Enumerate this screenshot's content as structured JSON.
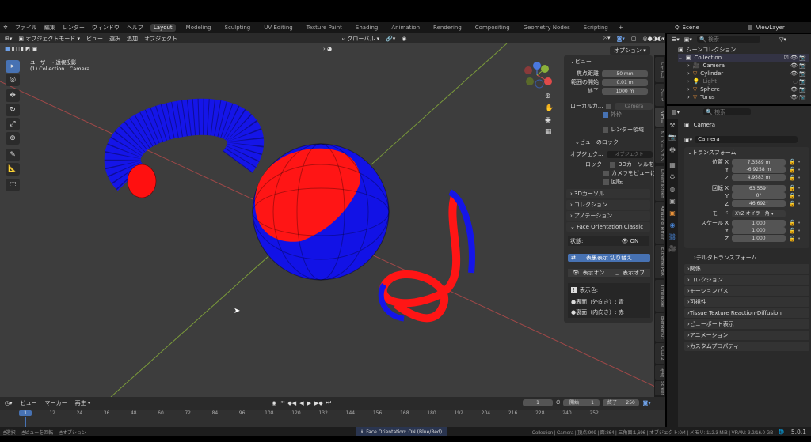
{
  "menu": {
    "items": [
      "ファイル",
      "編集",
      "レンダー",
      "ウィンドウ",
      "ヘルプ"
    ],
    "workspaces": [
      "Layout",
      "Modeling",
      "Sculpting",
      "UV Editing",
      "Texture Paint",
      "Shading",
      "Animation",
      "Rendering",
      "Compositing",
      "Geometry Nodes",
      "Scripting"
    ],
    "add_tab": "+",
    "scene": "Scene",
    "view_layer": "ViewLayer"
  },
  "viewport_header": {
    "mode": "オブジェクトモード",
    "menus": [
      "ビュー",
      "選択",
      "追加",
      "オブジェクト"
    ],
    "orientation": "グローバル",
    "options": "オプション"
  },
  "viewport": {
    "view_name": "ユーザー・透視投影",
    "context": "(1) Collection | Camera",
    "axes": {
      "x": "X",
      "y": "Y",
      "z": "Z"
    }
  },
  "npanel": {
    "view": {
      "title": "ビュー",
      "focal_label": "焦点距離",
      "focal": "50 mm",
      "clip_start_label": "範囲の開始",
      "clip_start": "0.01 m",
      "clip_end_label": "終了",
      "clip_end": "1000 m",
      "local_camera_label": "ローカルカ...",
      "local_camera": "Camera",
      "outline_label": "外枠",
      "render_region_label": "レンダー領域"
    },
    "view_lock": {
      "title": "ビューのロック",
      "object_label": "オブジェク...",
      "object_placeholder": "オブジェクト",
      "lock_label": "ロック",
      "lock_cursor": "3Dカーソルを注視",
      "lock_camera": "カメラをビューに",
      "lock_rotation": "回転"
    },
    "collapsed": [
      "3Dカーソル",
      "コレクション",
      "アノテーション"
    ],
    "face_orientation": {
      "title": "Face Orientation Classic",
      "state_label": "状態:",
      "state": "ON",
      "toggle_button": "表裏表示 切り替え",
      "show_on": "表示オン",
      "show_off": "表示オフ",
      "colors_label": "表示色:",
      "front": "表面（外向き）: 青",
      "back": "裏面（内向き）: 赤"
    }
  },
  "side_tabs": [
    "アイテム",
    "ツール",
    "ビュー",
    "アニメーション",
    "Dreamscreen",
    "Amazing Terrain",
    "Extreme PBR",
    "Timelapse",
    "BlenderKit",
    "OCD 2",
    "作成",
    "Screen"
  ],
  "outliner": {
    "search_placeholder": "検索",
    "scene_collection": "シーンコレクション",
    "collection": "Collection",
    "items": [
      "Camera",
      "Cylinder",
      "Light",
      "Sphere",
      "Torus"
    ]
  },
  "properties": {
    "search_placeholder": "検索",
    "object": "Camera",
    "object_data": "Camera",
    "transform": {
      "title": "トランスフォーム",
      "location_label": "位置 X",
      "location": [
        "7.3589 m",
        "-6.9258 m",
        "4.9583 m"
      ],
      "rotation_label": "回転 X",
      "rotation": [
        "63.559°",
        "0°",
        "46.692°"
      ],
      "mode_label": "モード",
      "mode": "XYZ オイラー角",
      "scale_label": "スケール X",
      "scale": [
        "1.000",
        "1.000",
        "1.000"
      ],
      "y": "Y",
      "z": "Z"
    },
    "delta": "デルタトランスフォーム",
    "sections": [
      "関係",
      "コレクション",
      "モーションパス",
      "可視性",
      "Tissue Texture Reaction-Diffusion",
      "ビューポート表示",
      "アニメーション",
      "カスタムプロパティ"
    ]
  },
  "timeline": {
    "menus": [
      "ビュー",
      "マーカー",
      "再生"
    ],
    "current_frame": "1",
    "start_label": "開始",
    "start": "1",
    "end_label": "終了",
    "end": "250",
    "ticks": [
      "1",
      "12",
      "24",
      "36",
      "48",
      "60",
      "72",
      "84",
      "96",
      "108",
      "120",
      "132",
      "144",
      "156",
      "168",
      "180",
      "192",
      "204",
      "216",
      "228",
      "240",
      "252"
    ]
  },
  "status": {
    "select": "選択",
    "rotate": "ビューを回転",
    "options": "オプション",
    "notice": "Face Orientation: ON (Blue/Red)",
    "stats": "Collection | Camera | 頂点:909 | 面:864 | 三角面:1,696 | オブジェクト:0/4 | メモリ: 112.3 MiB | VRAM: 3.2/16.0 GB |",
    "version": "5.0.1"
  },
  "colors": {
    "front": "#1a1aff",
    "back": "#ff1a1a",
    "accent": "#4772b3"
  }
}
